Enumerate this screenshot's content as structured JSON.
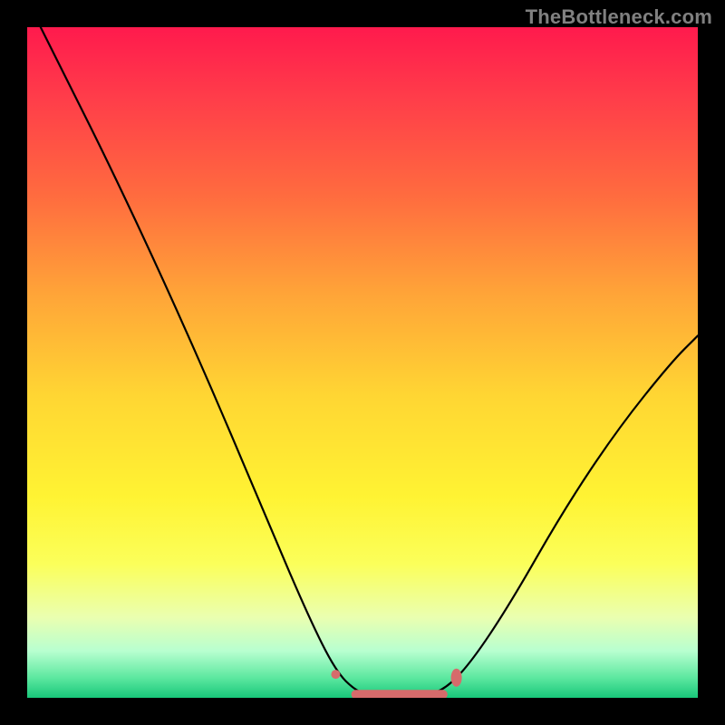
{
  "watermark": "TheBottleneck.com",
  "colors": {
    "gradient_top": "#ff1a4d",
    "gradient_bottom": "#18c77a",
    "curve": "#000000",
    "marker": "#d66b6b",
    "frame": "#000000"
  },
  "chart_data": {
    "type": "line",
    "title": "",
    "xlabel": "",
    "ylabel": "",
    "xlim": [
      0,
      100
    ],
    "ylim": [
      0,
      100
    ],
    "grid": false,
    "legend": false,
    "curve_points": [
      {
        "x": 2,
        "y": 100
      },
      {
        "x": 6,
        "y": 92
      },
      {
        "x": 12,
        "y": 80
      },
      {
        "x": 20,
        "y": 63
      },
      {
        "x": 28,
        "y": 45
      },
      {
        "x": 36,
        "y": 26
      },
      {
        "x": 42,
        "y": 12
      },
      {
        "x": 46,
        "y": 4
      },
      {
        "x": 49,
        "y": 1
      },
      {
        "x": 52,
        "y": 0
      },
      {
        "x": 58,
        "y": 0
      },
      {
        "x": 62,
        "y": 1
      },
      {
        "x": 66,
        "y": 5
      },
      {
        "x": 72,
        "y": 14
      },
      {
        "x": 80,
        "y": 28
      },
      {
        "x": 88,
        "y": 40
      },
      {
        "x": 96,
        "y": 50
      },
      {
        "x": 100,
        "y": 54
      }
    ],
    "optimal_range": {
      "x_start": 49,
      "x_end": 62,
      "y": 0.5
    },
    "markers": [
      {
        "name": "left-dot",
        "x": 46,
        "y": 3.5
      },
      {
        "name": "right-blip",
        "x": 64,
        "y": 3
      }
    ]
  }
}
